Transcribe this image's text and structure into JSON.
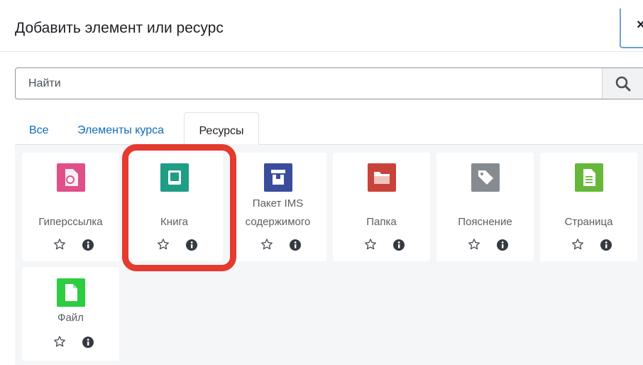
{
  "modal": {
    "title": "Добавить элемент или ресурс",
    "close_glyph": "×"
  },
  "search": {
    "placeholder": "Найти",
    "icon": "search-icon"
  },
  "tabs": [
    {
      "label": "Все",
      "active": false
    },
    {
      "label": "Элементы курса",
      "active": false
    },
    {
      "label": "Ресурсы",
      "active": true
    }
  ],
  "items": [
    {
      "line1": "",
      "line2": "Гиперссылка",
      "icon": "url-icon",
      "color": "#e04f87"
    },
    {
      "line1": "",
      "line2": "Книга",
      "icon": "book-icon",
      "color": "#1f9d85",
      "highlighted": true
    },
    {
      "line1": "Пакет IMS",
      "line2": "содержимого",
      "icon": "ims-package-icon",
      "color": "#3b4c9b"
    },
    {
      "line1": "",
      "line2": "Папка",
      "icon": "folder-icon",
      "color": "#c8433a"
    },
    {
      "line1": "",
      "line2": "Пояснение",
      "icon": "label-icon",
      "color": "#858b91"
    },
    {
      "line1": "",
      "line2": "Страница",
      "icon": "page-icon",
      "color": "#67b83a"
    },
    {
      "line1": "",
      "line2": "Файл",
      "icon": "file-icon",
      "color": "#2ecc40"
    }
  ],
  "colors": {
    "link": "#0f6cbf",
    "highlight": "#e53a2f",
    "panel_bg": "#f5f6f8"
  }
}
